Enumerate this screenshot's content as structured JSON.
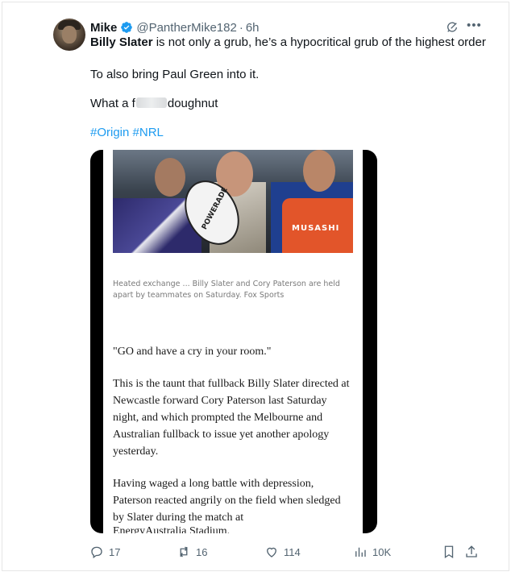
{
  "author": {
    "name": "Mike",
    "handle": "@PantherMike182",
    "separator": "·",
    "time": "6h"
  },
  "tweet": {
    "line1_bold": "Billy Slater",
    "line1_rest": " is not only a grub, he’s a hypocritical grub of the highest order",
    "line2": "To also bring Paul Green into it.",
    "line3_start": "What a f",
    "line3_end": "doughnut",
    "hashtag1": "#Origin",
    "hashtag2": "#NRL"
  },
  "media": {
    "ball_text": "POWERADE",
    "sponsor_text": "MUSASHI",
    "caption": "Heated exchange ... Billy Slater and Cory Paterson are held apart by teammates on Saturday. Fox Sports",
    "para1": "\"GO and have a cry in your room.\"",
    "para2": "This is the taunt that fullback Billy Slater directed at Newcastle forward Cory Paterson last Saturday night, and which prompted the Melbourne and Australian fullback to issue yet another apology yesterday.",
    "para3": "Having waged a long battle with depression, Paterson reacted angrily on the field when sledged by Slater during the match at",
    "para4_cut": "EnergyAustralia Stadium."
  },
  "actions": {
    "replies": "17",
    "reposts": "16",
    "likes": "114",
    "views": "10K"
  },
  "colors": {
    "link": "#1d9bf0",
    "muted": "#536471",
    "verified": "#1d9bf0"
  }
}
